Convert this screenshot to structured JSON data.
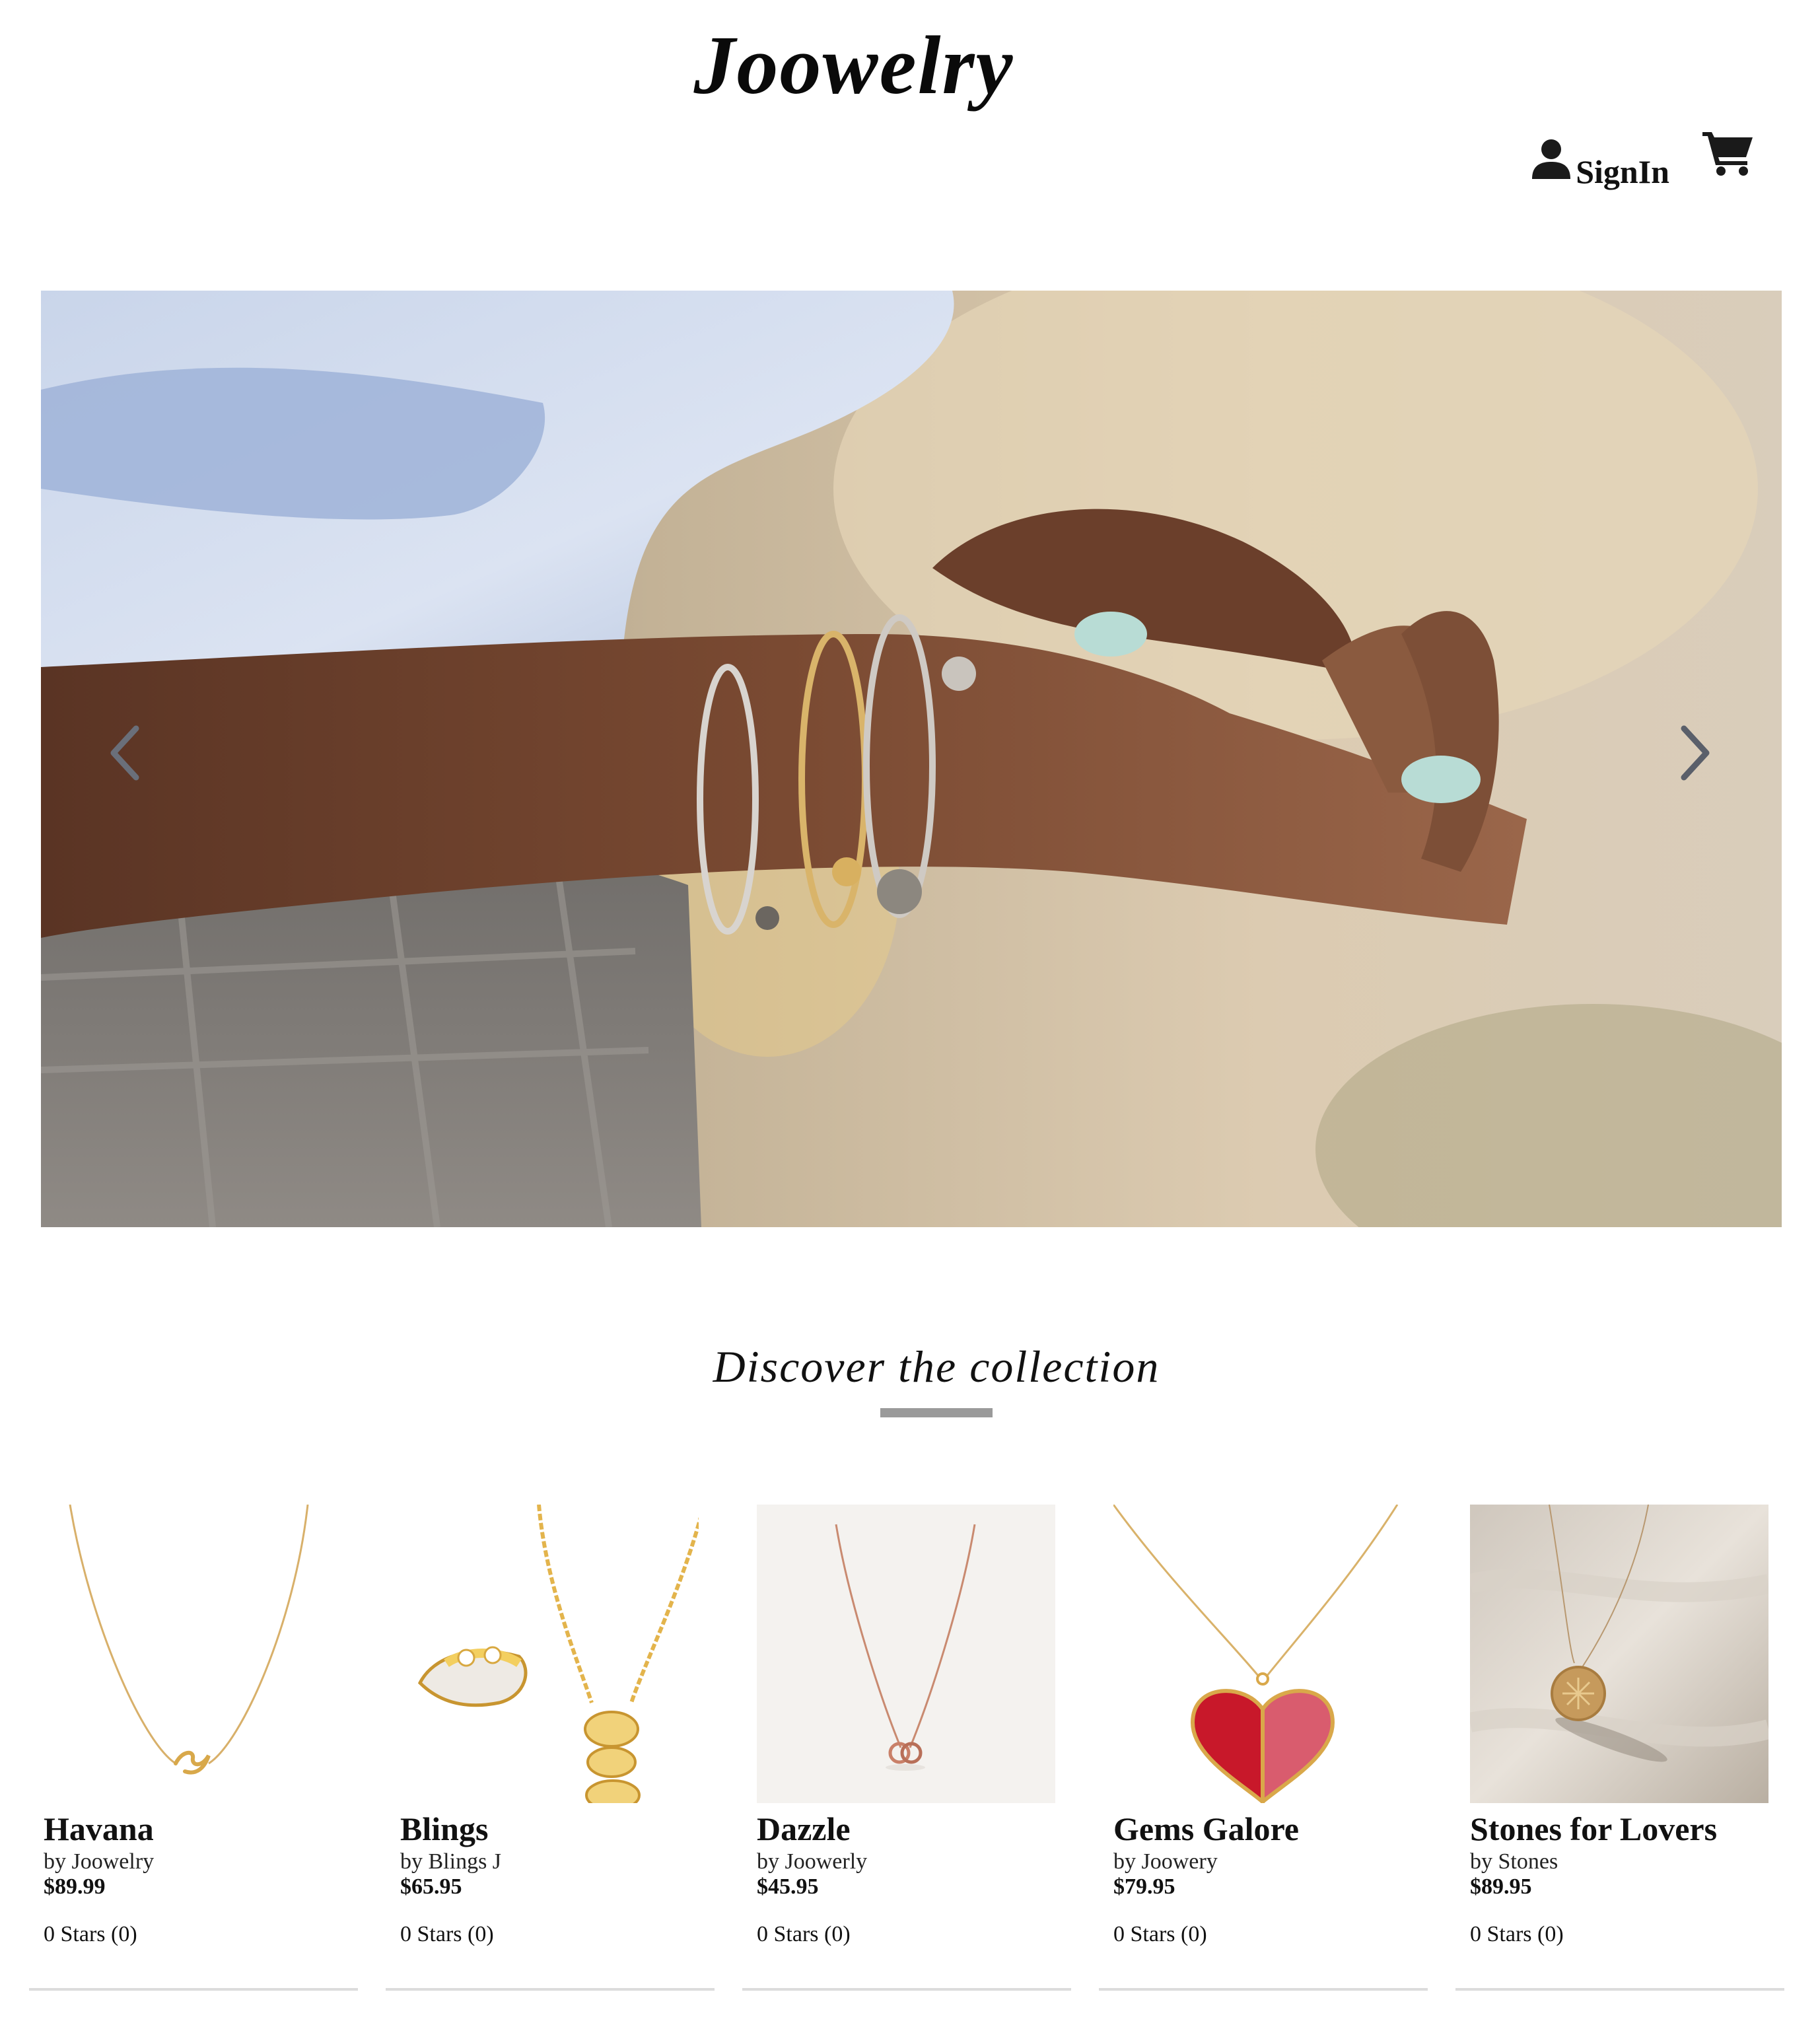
{
  "header": {
    "brand": "Joowelry",
    "signin_label": "SignIn",
    "user_icon": "user-icon",
    "cart_icon": "cart-icon"
  },
  "hero": {
    "prev_icon": "chevron-left-icon",
    "next_icon": "chevron-right-icon"
  },
  "collection": {
    "title": "Discover the collection"
  },
  "products": [
    {
      "name": "Havana",
      "maker": "by Joowelry",
      "price": "$89.99",
      "rating": "0 Stars (0)"
    },
    {
      "name": "Blings",
      "maker": "by Blings J",
      "price": "$65.95",
      "rating": "0 Stars (0)"
    },
    {
      "name": "Dazzle",
      "maker": "by Joowerly",
      "price": "$45.95",
      "rating": "0 Stars (0)"
    },
    {
      "name": "Gems Galore",
      "maker": "by Joowery",
      "price": "$79.95",
      "rating": "0 Stars (0)"
    },
    {
      "name": "Stones for Lovers",
      "maker": "by Stones",
      "price": "$89.95",
      "rating": "0 Stars (0)"
    }
  ],
  "colors": {
    "text": "#111111",
    "rule": "#9a9a9a",
    "divider": "#dcdcdc",
    "gold": "#d8a84a",
    "heart_red": "#c8182a",
    "heart_pink": "#d95c6e"
  }
}
